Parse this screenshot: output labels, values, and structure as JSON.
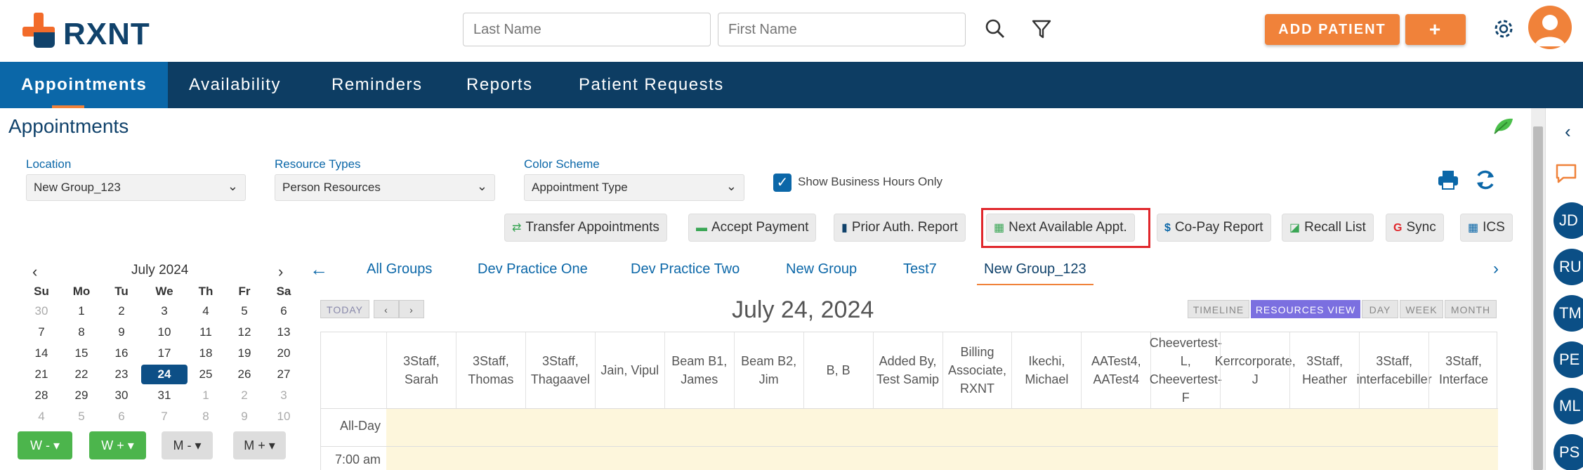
{
  "header": {
    "logo_text": "RXNT",
    "last_name_placeholder": "Last Name",
    "first_name_placeholder": "First Name",
    "add_patient_label": "ADD PATIENT",
    "plus_label": "+"
  },
  "nav": {
    "items": [
      {
        "label": "Appointments"
      },
      {
        "label": "Availability"
      },
      {
        "label": "Reminders"
      },
      {
        "label": "Reports"
      },
      {
        "label": "Patient Requests"
      }
    ]
  },
  "page": {
    "title": "Appointments"
  },
  "filters": {
    "location": {
      "label": "Location",
      "value": "New Group_123"
    },
    "resource_types": {
      "label": "Resource Types",
      "value": "Person Resources"
    },
    "color_scheme": {
      "label": "Color Scheme",
      "value": "Appointment Type"
    },
    "business_hours": {
      "label": "Show Business Hours Only",
      "checked": true
    }
  },
  "toolbar": {
    "buttons": [
      {
        "label": "Transfer Appointments",
        "icon": "⇄"
      },
      {
        "label": "Accept Payment",
        "icon": "▬"
      },
      {
        "label": "Prior Auth. Report",
        "icon": "▮"
      },
      {
        "label": "Next Available Appt.",
        "icon": "▦"
      },
      {
        "label": "Co-Pay Report",
        "icon": "$"
      },
      {
        "label": "Recall List",
        "icon": "◪"
      },
      {
        "label": "Sync",
        "icon": "G"
      },
      {
        "label": "ICS",
        "icon": "▦"
      }
    ]
  },
  "calendar": {
    "month_label": "July 2024",
    "weekdays": [
      "Su",
      "Mo",
      "Tu",
      "We",
      "Th",
      "Fr",
      "Sa"
    ],
    "weeks": [
      [
        "30",
        "1",
        "2",
        "3",
        "4",
        "5",
        "6"
      ],
      [
        "7",
        "8",
        "9",
        "10",
        "11",
        "12",
        "13"
      ],
      [
        "14",
        "15",
        "16",
        "17",
        "18",
        "19",
        "20"
      ],
      [
        "21",
        "22",
        "23",
        "24",
        "25",
        "26",
        "27"
      ],
      [
        "28",
        "29",
        "30",
        "31",
        "1",
        "2",
        "3"
      ],
      [
        "4",
        "5",
        "6",
        "7",
        "8",
        "9",
        "10"
      ]
    ],
    "selected": "24",
    "view_buttons": [
      "W -",
      "W +",
      "M -",
      "M +"
    ]
  },
  "groups": {
    "tabs": [
      "All Groups",
      "Dev Practice One",
      "Dev Practice Two",
      "New Group",
      "Test7",
      "New Group_123"
    ],
    "active": "New Group_123"
  },
  "schedule": {
    "today_label": "TODAY",
    "date": "July 24, 2024",
    "views": [
      "TIMELINE",
      "RESOURCES VIEW",
      "DAY",
      "WEEK",
      "MONTH"
    ],
    "active_view": "RESOURCES VIEW",
    "columns": [
      "3Staff, Sarah",
      "3Staff, Thomas",
      "3Staff, Thagaavel",
      "Jain, Vipul",
      "Beam B1, James",
      "Beam B2, Jim",
      "B, B",
      "Added By, Test Samip",
      "Billing Associate, RXNT",
      "Ikechi, Michael",
      "AATest4, AATest4",
      "Cheevertest-L, Cheevertest-F",
      "Kerrcorporate, J",
      "3Staff, Heather",
      "3Staff, interfacebiller",
      "3Staff, Interface"
    ],
    "all_day_label": "All-Day",
    "time_label": "7:00 am"
  },
  "rail": {
    "avatars": [
      "JD",
      "RU",
      "TM",
      "PE",
      "ML",
      "PS"
    ]
  },
  "colors": {
    "navy": "#0d3d63",
    "blue": "#0b67a8",
    "orange": "#f0823a",
    "highlight": "#e0262b"
  }
}
